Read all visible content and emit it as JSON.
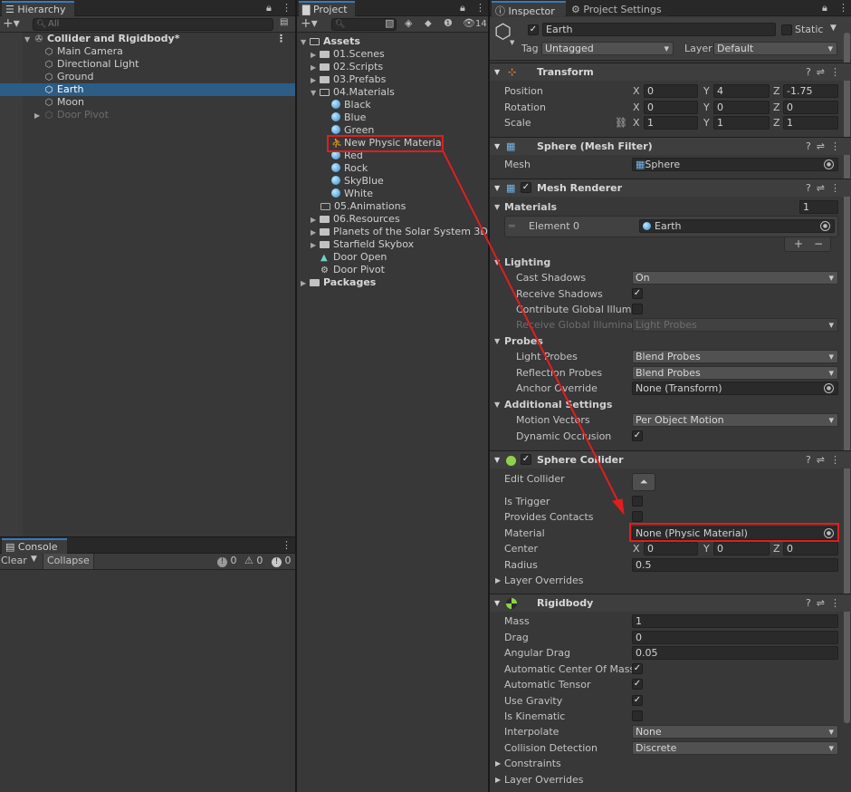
{
  "hierarchy": {
    "tab": "Hierarchy",
    "search_placeholder": "All",
    "scene": "Collider and Rigidbody*",
    "items": [
      {
        "label": "Main Camera"
      },
      {
        "label": "Directional Light"
      },
      {
        "label": "Ground"
      },
      {
        "label": "Earth"
      },
      {
        "label": "Moon"
      },
      {
        "label": "Door Pivot"
      }
    ]
  },
  "console": {
    "tab": "Console",
    "clear_label": "Clear",
    "collapse_label": "Collapse",
    "info_count": "0",
    "warn_count": "0",
    "error_count": "0"
  },
  "project": {
    "tab": "Project",
    "hidden_count": "14",
    "root": "Assets",
    "items": [
      {
        "label": "01.Scenes"
      },
      {
        "label": "02.Scripts"
      },
      {
        "label": "03.Prefabs"
      },
      {
        "label": "04.Materials"
      },
      {
        "label": "Black"
      },
      {
        "label": "Blue"
      },
      {
        "label": "Green"
      },
      {
        "label": "New Physic Material"
      },
      {
        "label": "Red"
      },
      {
        "label": "Rock"
      },
      {
        "label": "SkyBlue"
      },
      {
        "label": "White"
      },
      {
        "label": "05.Animations"
      },
      {
        "label": "06.Resources"
      },
      {
        "label": "Planets of the Solar System 3D"
      },
      {
        "label": "Starfield Skybox"
      },
      {
        "label": "Door Open"
      },
      {
        "label": "Door Pivot"
      },
      {
        "label": "Packages"
      }
    ]
  },
  "inspector": {
    "tab": "Inspector",
    "tab2": "Project Settings",
    "object_name": "Earth",
    "static_label": "Static",
    "tag_label": "Tag",
    "tag_value": "Untagged",
    "layer_label": "Layer",
    "layer_value": "Default",
    "transform": {
      "title": "Transform",
      "position_label": "Position",
      "rotation_label": "Rotation",
      "scale_label": "Scale",
      "position": [
        "0",
        "4",
        "-1.75"
      ],
      "rotation": [
        "0",
        "0",
        "0"
      ],
      "scale": [
        "1",
        "1",
        "1"
      ],
      "axis_x": "X",
      "axis_y": "Y",
      "axis_z": "Z"
    },
    "mesh_filter": {
      "title": "Sphere (Mesh Filter)",
      "mesh_label": "Mesh",
      "mesh_value": "Sphere"
    },
    "mesh_renderer": {
      "title": "Mesh Renderer",
      "materials_label": "Materials",
      "materials_count": "1",
      "element_label": "Element 0",
      "element_value": "Earth",
      "lighting_label": "Lighting",
      "cast_shadows_label": "Cast Shadows",
      "cast_shadows_value": "On",
      "receive_shadows_label": "Receive Shadows",
      "contribute_gi_label": "Contribute Global Illumina",
      "receive_gi_label": "Receive Global Illuminati",
      "receive_gi_value": "Light Probes",
      "probes_label": "Probes",
      "light_probes_label": "Light Probes",
      "light_probes_value": "Blend Probes",
      "reflection_probes_label": "Reflection Probes",
      "reflection_probes_value": "Blend Probes",
      "anchor_override_label": "Anchor Override",
      "anchor_override_value": "None (Transform)",
      "additional_label": "Additional Settings",
      "motion_vectors_label": "Motion Vectors",
      "motion_vectors_value": "Per Object Motion",
      "dynamic_occlusion_label": "Dynamic Occlusion"
    },
    "sphere_collider": {
      "title": "Sphere Collider",
      "edit_collider_label": "Edit Collider",
      "is_trigger_label": "Is Trigger",
      "provides_contacts_label": "Provides Contacts",
      "material_label": "Material",
      "material_value": "None (Physic Material)",
      "center_label": "Center",
      "center": [
        "0",
        "0",
        "0"
      ],
      "radius_label": "Radius",
      "radius_value": "0.5",
      "layer_overrides_label": "Layer Overrides"
    },
    "rigidbody": {
      "title": "Rigidbody",
      "mass_label": "Mass",
      "mass_value": "1",
      "drag_label": "Drag",
      "drag_value": "0",
      "angular_drag_label": "Angular Drag",
      "angular_drag_value": "0.05",
      "auto_com_label": "Automatic Center Of Mass",
      "auto_tensor_label": "Automatic Tensor",
      "use_gravity_label": "Use Gravity",
      "is_kinematic_label": "Is Kinematic",
      "interpolate_label": "Interpolate",
      "interpolate_value": "None",
      "collision_label": "Collision Detection",
      "collision_value": "Discrete",
      "constraints_label": "Constraints",
      "layer_overrides_label": "Layer Overrides"
    }
  },
  "annotation": {
    "color": "#e01e1e"
  }
}
